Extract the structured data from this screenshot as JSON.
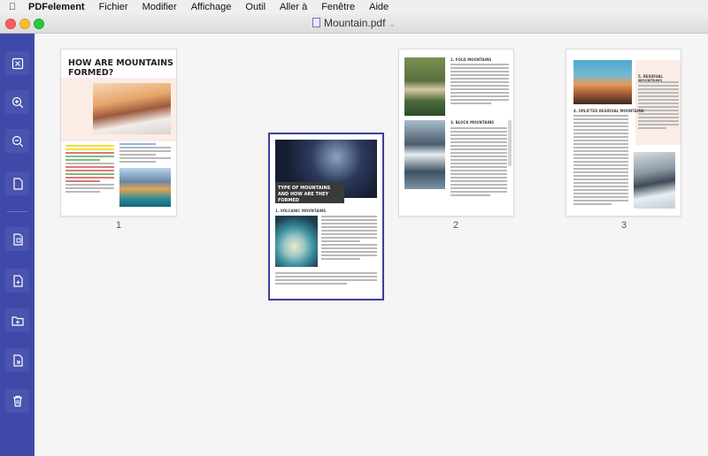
{
  "menubar": {
    "apple_icon": "apple-icon",
    "app_name": "PDFelement",
    "items": [
      "Fichier",
      "Modifier",
      "Affichage",
      "Outil",
      "Aller à",
      "Fenêtre",
      "Aide"
    ]
  },
  "window": {
    "title": "Mountain.pdf",
    "file_icon": "pdf-file-icon",
    "dropdown_icon": "chevron-down-icon"
  },
  "sidebar": {
    "icons": [
      "close-page-icon",
      "zoom-in-icon",
      "zoom-out-icon",
      "blank-page-icon",
      "extract-page-icon",
      "insert-page-icon",
      "insert-folder-icon",
      "replace-page-icon",
      "delete-page-icon"
    ],
    "accent": "#3f49a8"
  },
  "pages": [
    {
      "number": "1",
      "heading": "HOW ARE MOUNTAINS FORMED?",
      "selected": false
    },
    {
      "number": "",
      "heading": "TYPE OF MOUNTAINS AND HOW ARE THEY FORMED",
      "subheading": "1. VOLCANIC MOUNTAINS",
      "selected": true
    },
    {
      "number": "2",
      "subheadings": [
        "2. FOLD MOUNTAINS",
        "3. BLOCK MOUNTAINS"
      ],
      "selected": false
    },
    {
      "number": "3",
      "subheadings": [
        "4. UPLIFTED RESIDUAL MOUNTAINS",
        "5. RESIDUAL MOUNTAINS"
      ],
      "selected": false
    }
  ]
}
